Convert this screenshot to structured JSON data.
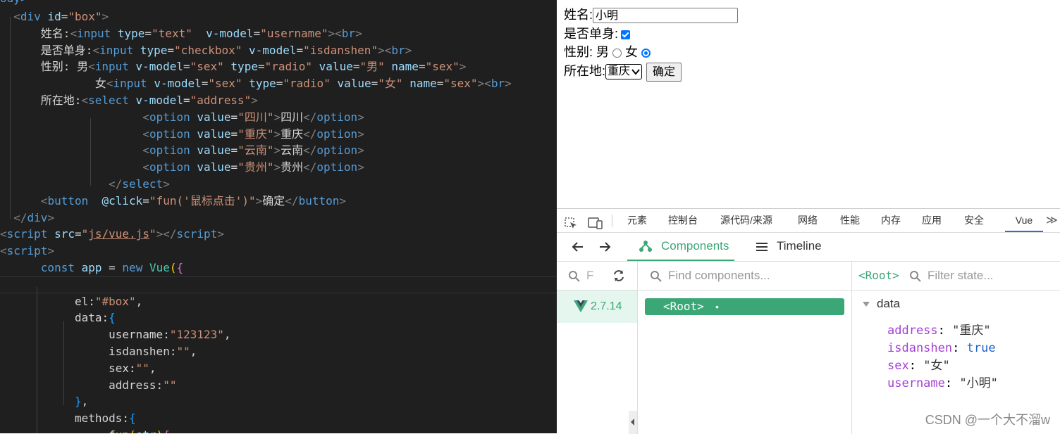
{
  "editor": {
    "lines": [
      [
        [
          "t-tag",
          "ody>"
        ]
      ],
      [
        [
          "t-txt",
          "  "
        ],
        [
          "t-br",
          "<"
        ],
        [
          "t-tag",
          "div"
        ],
        [
          "t-txt",
          " "
        ],
        [
          "t-at",
          "id"
        ],
        [
          "t-txt",
          "="
        ],
        [
          "t-str",
          "\"box\""
        ],
        [
          "t-br",
          ">"
        ]
      ],
      [
        [
          "t-txt",
          "      姓名:"
        ],
        [
          "t-br",
          "<"
        ],
        [
          "t-tag",
          "input"
        ],
        [
          "t-txt",
          " "
        ],
        [
          "t-at",
          "type"
        ],
        [
          "t-txt",
          "="
        ],
        [
          "t-str",
          "\"text\""
        ],
        [
          "t-txt",
          "  "
        ],
        [
          "t-at",
          "v-model"
        ],
        [
          "t-txt",
          "="
        ],
        [
          "t-str",
          "\"username\""
        ],
        [
          "t-br",
          "><"
        ],
        [
          "t-tag",
          "br"
        ],
        [
          "t-br",
          ">"
        ]
      ],
      [
        [
          "t-txt",
          "      是否单身:"
        ],
        [
          "t-br",
          "<"
        ],
        [
          "t-tag",
          "input"
        ],
        [
          "t-txt",
          " "
        ],
        [
          "t-at",
          "type"
        ],
        [
          "t-txt",
          "="
        ],
        [
          "t-str",
          "\"checkbox\""
        ],
        [
          "t-txt",
          " "
        ],
        [
          "t-at",
          "v-model"
        ],
        [
          "t-txt",
          "="
        ],
        [
          "t-str",
          "\"isdanshen\""
        ],
        [
          "t-br",
          "><"
        ],
        [
          "t-tag",
          "br"
        ],
        [
          "t-br",
          ">"
        ]
      ],
      [
        [
          "t-txt",
          "      性别: 男"
        ],
        [
          "t-br",
          "<"
        ],
        [
          "t-tag",
          "input"
        ],
        [
          "t-txt",
          " "
        ],
        [
          "t-at",
          "v-model"
        ],
        [
          "t-txt",
          "="
        ],
        [
          "t-str",
          "\"sex\""
        ],
        [
          "t-txt",
          " "
        ],
        [
          "t-at",
          "type"
        ],
        [
          "t-txt",
          "="
        ],
        [
          "t-str",
          "\"radio\""
        ],
        [
          "t-txt",
          " "
        ],
        [
          "t-at",
          "value"
        ],
        [
          "t-txt",
          "="
        ],
        [
          "t-str",
          "\"男\""
        ],
        [
          "t-txt",
          " "
        ],
        [
          "t-at",
          "name"
        ],
        [
          "t-txt",
          "="
        ],
        [
          "t-str",
          "\"sex\""
        ],
        [
          "t-br",
          ">"
        ]
      ],
      [
        [
          "t-txt",
          "              女"
        ],
        [
          "t-br",
          "<"
        ],
        [
          "t-tag",
          "input"
        ],
        [
          "t-txt",
          " "
        ],
        [
          "t-at",
          "v-model"
        ],
        [
          "t-txt",
          "="
        ],
        [
          "t-str",
          "\"sex\""
        ],
        [
          "t-txt",
          " "
        ],
        [
          "t-at",
          "type"
        ],
        [
          "t-txt",
          "="
        ],
        [
          "t-str",
          "\"radio\""
        ],
        [
          "t-txt",
          " "
        ],
        [
          "t-at",
          "value"
        ],
        [
          "t-txt",
          "="
        ],
        [
          "t-str",
          "\"女\""
        ],
        [
          "t-txt",
          " "
        ],
        [
          "t-at",
          "name"
        ],
        [
          "t-txt",
          "="
        ],
        [
          "t-str",
          "\"sex\""
        ],
        [
          "t-br",
          "><"
        ],
        [
          "t-tag",
          "br"
        ],
        [
          "t-br",
          ">"
        ]
      ],
      [
        [
          "t-txt",
          "      所在地:"
        ],
        [
          "t-br",
          "<"
        ],
        [
          "t-tag",
          "select"
        ],
        [
          "t-txt",
          " "
        ],
        [
          "t-at",
          "v-model"
        ],
        [
          "t-txt",
          "="
        ],
        [
          "t-str",
          "\"address\""
        ],
        [
          "t-br",
          ">"
        ]
      ],
      [
        [
          "t-txt",
          "                     "
        ],
        [
          "t-br",
          "<"
        ],
        [
          "t-tag",
          "option"
        ],
        [
          "t-txt",
          " "
        ],
        [
          "t-at",
          "value"
        ],
        [
          "t-txt",
          "="
        ],
        [
          "t-str",
          "\"四川\""
        ],
        [
          "t-br",
          ">"
        ],
        [
          "t-txt",
          "四川"
        ],
        [
          "t-br",
          "</"
        ],
        [
          "t-tag",
          "option"
        ],
        [
          "t-br",
          ">"
        ]
      ],
      [
        [
          "t-txt",
          "                     "
        ],
        [
          "t-br",
          "<"
        ],
        [
          "t-tag",
          "option"
        ],
        [
          "t-txt",
          " "
        ],
        [
          "t-at",
          "value"
        ],
        [
          "t-txt",
          "="
        ],
        [
          "t-str",
          "\"重庆\""
        ],
        [
          "t-br",
          ">"
        ],
        [
          "t-txt",
          "重庆"
        ],
        [
          "t-br",
          "</"
        ],
        [
          "t-tag",
          "option"
        ],
        [
          "t-br",
          ">"
        ]
      ],
      [
        [
          "t-txt",
          "                     "
        ],
        [
          "t-br",
          "<"
        ],
        [
          "t-tag",
          "option"
        ],
        [
          "t-txt",
          " "
        ],
        [
          "t-at",
          "value"
        ],
        [
          "t-txt",
          "="
        ],
        [
          "t-str",
          "\"云南\""
        ],
        [
          "t-br",
          ">"
        ],
        [
          "t-txt",
          "云南"
        ],
        [
          "t-br",
          "</"
        ],
        [
          "t-tag",
          "option"
        ],
        [
          "t-br",
          ">"
        ]
      ],
      [
        [
          "t-txt",
          "                     "
        ],
        [
          "t-br",
          "<"
        ],
        [
          "t-tag",
          "option"
        ],
        [
          "t-txt",
          " "
        ],
        [
          "t-at",
          "value"
        ],
        [
          "t-txt",
          "="
        ],
        [
          "t-str",
          "\"贵州\""
        ],
        [
          "t-br",
          ">"
        ],
        [
          "t-txt",
          "贵州"
        ],
        [
          "t-br",
          "</"
        ],
        [
          "t-tag",
          "option"
        ],
        [
          "t-br",
          ">"
        ]
      ],
      [
        [
          "t-txt",
          "                "
        ],
        [
          "t-br",
          "</"
        ],
        [
          "t-tag",
          "select"
        ],
        [
          "t-br",
          ">"
        ]
      ],
      [
        [
          "t-txt",
          "      "
        ],
        [
          "t-br",
          "<"
        ],
        [
          "t-tag",
          "button"
        ],
        [
          "t-txt",
          "  "
        ],
        [
          "t-at",
          "@click"
        ],
        [
          "t-txt",
          "="
        ],
        [
          "t-str",
          "\"fun('鼠标点击')\""
        ],
        [
          "t-br",
          ">"
        ],
        [
          "t-txt",
          "确定"
        ],
        [
          "t-br",
          "</"
        ],
        [
          "t-tag",
          "button"
        ],
        [
          "t-br",
          ">"
        ]
      ],
      [
        [
          "t-txt",
          "  "
        ],
        [
          "t-br",
          "</"
        ],
        [
          "t-tag",
          "div"
        ],
        [
          "t-br",
          ">"
        ]
      ],
      [
        [
          "t-br",
          "<"
        ],
        [
          "t-tag",
          "script"
        ],
        [
          "t-txt",
          " "
        ],
        [
          "t-at",
          "src"
        ],
        [
          "t-txt",
          "="
        ],
        [
          "t-str",
          "\""
        ],
        [
          "t-str t-u",
          "js/vue.js"
        ],
        [
          "t-str",
          "\""
        ],
        [
          "t-br",
          "></"
        ],
        [
          "t-tag",
          "script"
        ],
        [
          "t-br",
          ">"
        ]
      ],
      [
        [
          "t-br",
          "<"
        ],
        [
          "t-tag",
          "script"
        ],
        [
          "t-br",
          ">"
        ]
      ],
      [
        [
          "t-txt",
          "      "
        ],
        [
          "t-kw",
          "const"
        ],
        [
          "t-txt",
          " "
        ],
        [
          "t-at",
          "app"
        ],
        [
          "t-txt",
          " = "
        ],
        [
          "t-kw",
          "new"
        ],
        [
          "t-txt",
          " "
        ],
        [
          "t-cls",
          "Vue"
        ],
        [
          "t-brk",
          "("
        ],
        [
          "t-brk2",
          "{"
        ]
      ],
      [
        [
          "t-txt",
          ""
        ]
      ],
      [
        [
          "t-txt",
          "           el:"
        ],
        [
          "t-str",
          "\"#box\""
        ],
        [
          "t-txt",
          ","
        ]
      ],
      [
        [
          "t-txt",
          "           data:"
        ],
        [
          "t-brk3",
          "{"
        ]
      ],
      [
        [
          "t-txt",
          "                username:"
        ],
        [
          "t-str",
          "\"123123\""
        ],
        [
          "t-txt",
          ","
        ]
      ],
      [
        [
          "t-txt",
          "                isdanshen:"
        ],
        [
          "t-str",
          "\"\""
        ],
        [
          "t-txt",
          ","
        ]
      ],
      [
        [
          "t-txt",
          "                sex:"
        ],
        [
          "t-str",
          "\"\""
        ],
        [
          "t-txt",
          ","
        ]
      ],
      [
        [
          "t-txt",
          "                address:"
        ],
        [
          "t-str",
          "\"\""
        ]
      ],
      [
        [
          "t-txt",
          "           "
        ],
        [
          "t-brk3",
          "}"
        ],
        [
          "t-txt",
          ","
        ]
      ],
      [
        [
          "t-txt",
          "           methods:"
        ],
        [
          "t-brk3",
          "{"
        ]
      ],
      [
        [
          "t-txt",
          "                "
        ],
        [
          "t-fn",
          "fun"
        ],
        [
          "t-brk",
          "("
        ],
        [
          "t-at",
          "str"
        ],
        [
          "t-brk",
          ")"
        ],
        [
          "t-brk2",
          "{"
        ]
      ]
    ]
  },
  "page": {
    "name_label": "姓名:",
    "name_value": "小明",
    "single_label": "是否单身:",
    "gender_label": "性别: 男",
    "gender_female": "女",
    "address_label": "所在地:",
    "address_selected": "重庆",
    "confirm_button": "确定"
  },
  "devtools": {
    "tabs": [
      "元素",
      "控制台",
      "源代码/来源",
      "网络",
      "性能",
      "内存",
      "应用",
      "安全",
      "Vue"
    ],
    "active_tab": "Vue",
    "overflow": "≫",
    "nav": {
      "components": "Components",
      "timeline": "Timeline"
    },
    "app_filter_placeholder": "F",
    "vue_version": "2.7.14",
    "find_placeholder": "Find components...",
    "root_component": "<Root>",
    "root_dot": "•",
    "selected_label": "<Root>",
    "filter_state_placeholder": "Filter state...",
    "data_section": "data",
    "state": [
      {
        "key": "address",
        "value": "\"重庆\""
      },
      {
        "key": "isdanshen",
        "value": "true"
      },
      {
        "key": "sex",
        "value": "\"女\""
      },
      {
        "key": "username",
        "value": "\"小明\""
      }
    ]
  },
  "watermark": "CSDN @一个大不溜w",
  "colors": {
    "editor_bg": "#1f1f1f",
    "vue_green": "#3ba776",
    "active_blue": "#1a73e8",
    "checkbox_blue": "#0075ff"
  }
}
